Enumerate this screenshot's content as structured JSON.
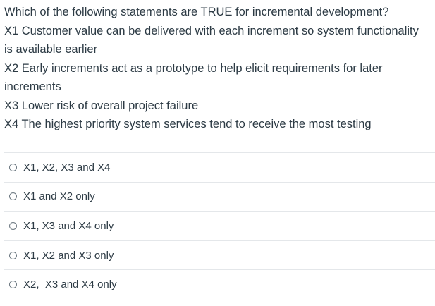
{
  "question": {
    "prompt": "Which of the following statements are TRUE for incremental development?",
    "statements": [
      "X1 Customer value can be delivered with each increment so system functionality is available earlier",
      "X2 Early increments act as a prototype to help elicit requirements for later increments",
      "X3 Lower risk of overall project failure",
      "X4 The highest priority system services tend to receive the most testing"
    ]
  },
  "answers": [
    {
      "label": "X1, X2, X3 and X4",
      "selected": false
    },
    {
      "label": "X1 and X2 only",
      "selected": false
    },
    {
      "label": "X1, X3 and X4 only",
      "selected": false
    },
    {
      "label": "X1, X2 and X3 only",
      "selected": false
    },
    {
      "label": "X2,  X3 and X4 only",
      "selected": false
    }
  ]
}
